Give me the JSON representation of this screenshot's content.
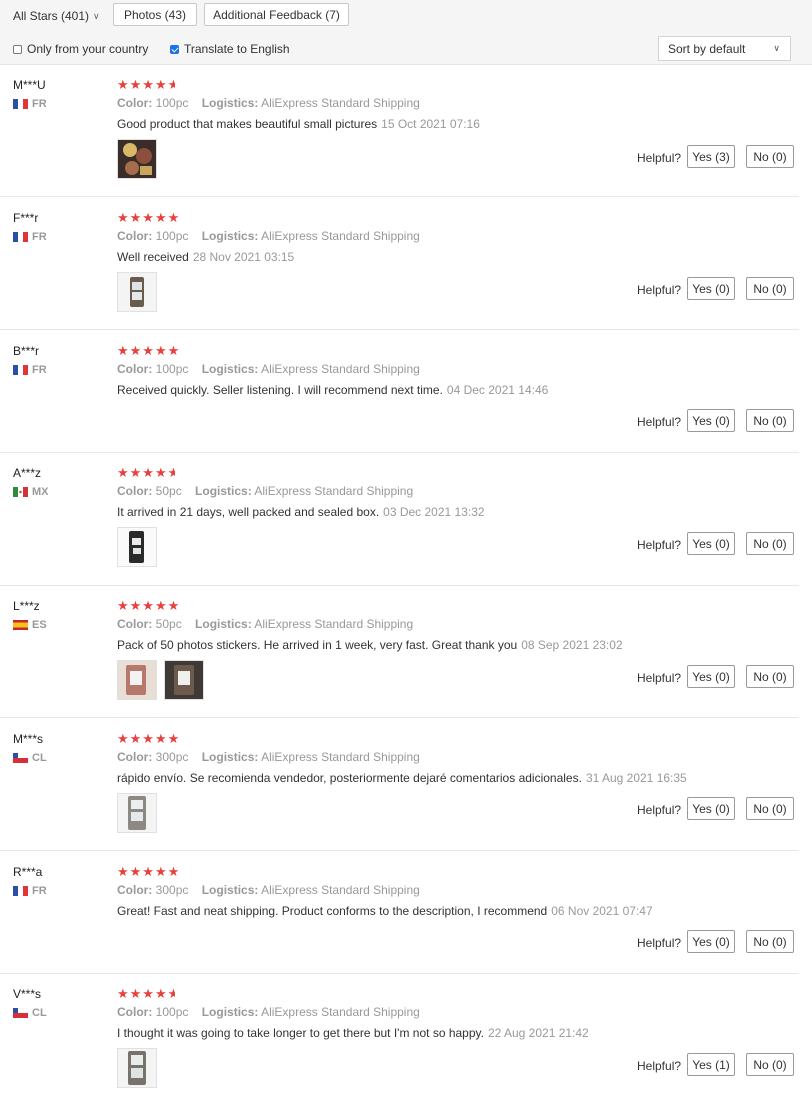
{
  "toolbar": {
    "filter_label": "All Stars (401)",
    "photos_label": "Photos (43)",
    "additional_label": "Additional Feedback (7)",
    "only_country_label": "Only from your country",
    "only_country_checked": false,
    "translate_label": "Translate to English",
    "translate_checked": true,
    "sort_value": "Sort by default"
  },
  "labels": {
    "color": "Color:",
    "logistics": "Logistics:",
    "helpful": "Helpful?"
  },
  "reviews": [
    {
      "name": "M***U",
      "country": "FR",
      "rating": 4.5,
      "color": "100pc",
      "logistics": "AliExpress Standard Shipping",
      "text": "Good product that makes beautiful small pictures",
      "date": "15 Oct 2021 07:16",
      "photos": 1,
      "yes": "Yes (3)",
      "no": "No (0)"
    },
    {
      "name": "F***r",
      "country": "FR",
      "rating": 5,
      "color": "100pc",
      "logistics": "AliExpress Standard Shipping",
      "text": "Well received",
      "date": "28 Nov 2021 03:15",
      "photos": 1,
      "yes": "Yes (0)",
      "no": "No (0)"
    },
    {
      "name": "B***r",
      "country": "FR",
      "rating": 5,
      "color": "100pc",
      "logistics": "AliExpress Standard Shipping",
      "text": "Received quickly. Seller listening. I will recommend next time.",
      "date": "04 Dec 2021 14:46",
      "photos": 0,
      "yes": "Yes (0)",
      "no": "No (0)"
    },
    {
      "name": "A***z",
      "country": "MX",
      "rating": 4.5,
      "color": "50pc",
      "logistics": "AliExpress Standard Shipping",
      "text": "It arrived in 21 days, well packed and sealed box.",
      "date": "03 Dec 2021 13:32",
      "photos": 1,
      "yes": "Yes (0)",
      "no": "No (0)"
    },
    {
      "name": "L***z",
      "country": "ES",
      "rating": 5,
      "color": "50pc",
      "logistics": "AliExpress Standard Shipping",
      "text": "Pack of 50 photos stickers. He arrived in 1 week, very fast. Great thank you",
      "date": "08 Sep 2021 23:02",
      "photos": 2,
      "yes": "Yes (0)",
      "no": "No (0)"
    },
    {
      "name": "M***s",
      "country": "CL",
      "rating": 5,
      "color": "300pc",
      "logistics": "AliExpress Standard Shipping",
      "text": "rápido envío. Se recomienda vendedor, posteriormente dejaré comentarios adicionales.",
      "date": "31 Aug 2021 16:35",
      "photos": 1,
      "yes": "Yes (0)",
      "no": "No (0)"
    },
    {
      "name": "R***a",
      "country": "FR",
      "rating": 5,
      "color": "300pc",
      "logistics": "AliExpress Standard Shipping",
      "text": "Great! Fast and neat shipping. Product conforms to the description, I recommend",
      "date": "06 Nov 2021 07:47",
      "photos": 0,
      "yes": "Yes (0)",
      "no": "No (0)"
    },
    {
      "name": "V***s",
      "country": "CL",
      "rating": 4.5,
      "color": "100pc",
      "logistics": "AliExpress Standard Shipping",
      "text": "I thought it was going to take longer to get there but I'm not so happy.",
      "date": "22 Aug 2021 21:42",
      "photos": 1,
      "yes": "Yes (1)",
      "no": "No (0)"
    }
  ],
  "colors": {
    "star": "#e8413d",
    "checkbox": "#1a73e8"
  }
}
